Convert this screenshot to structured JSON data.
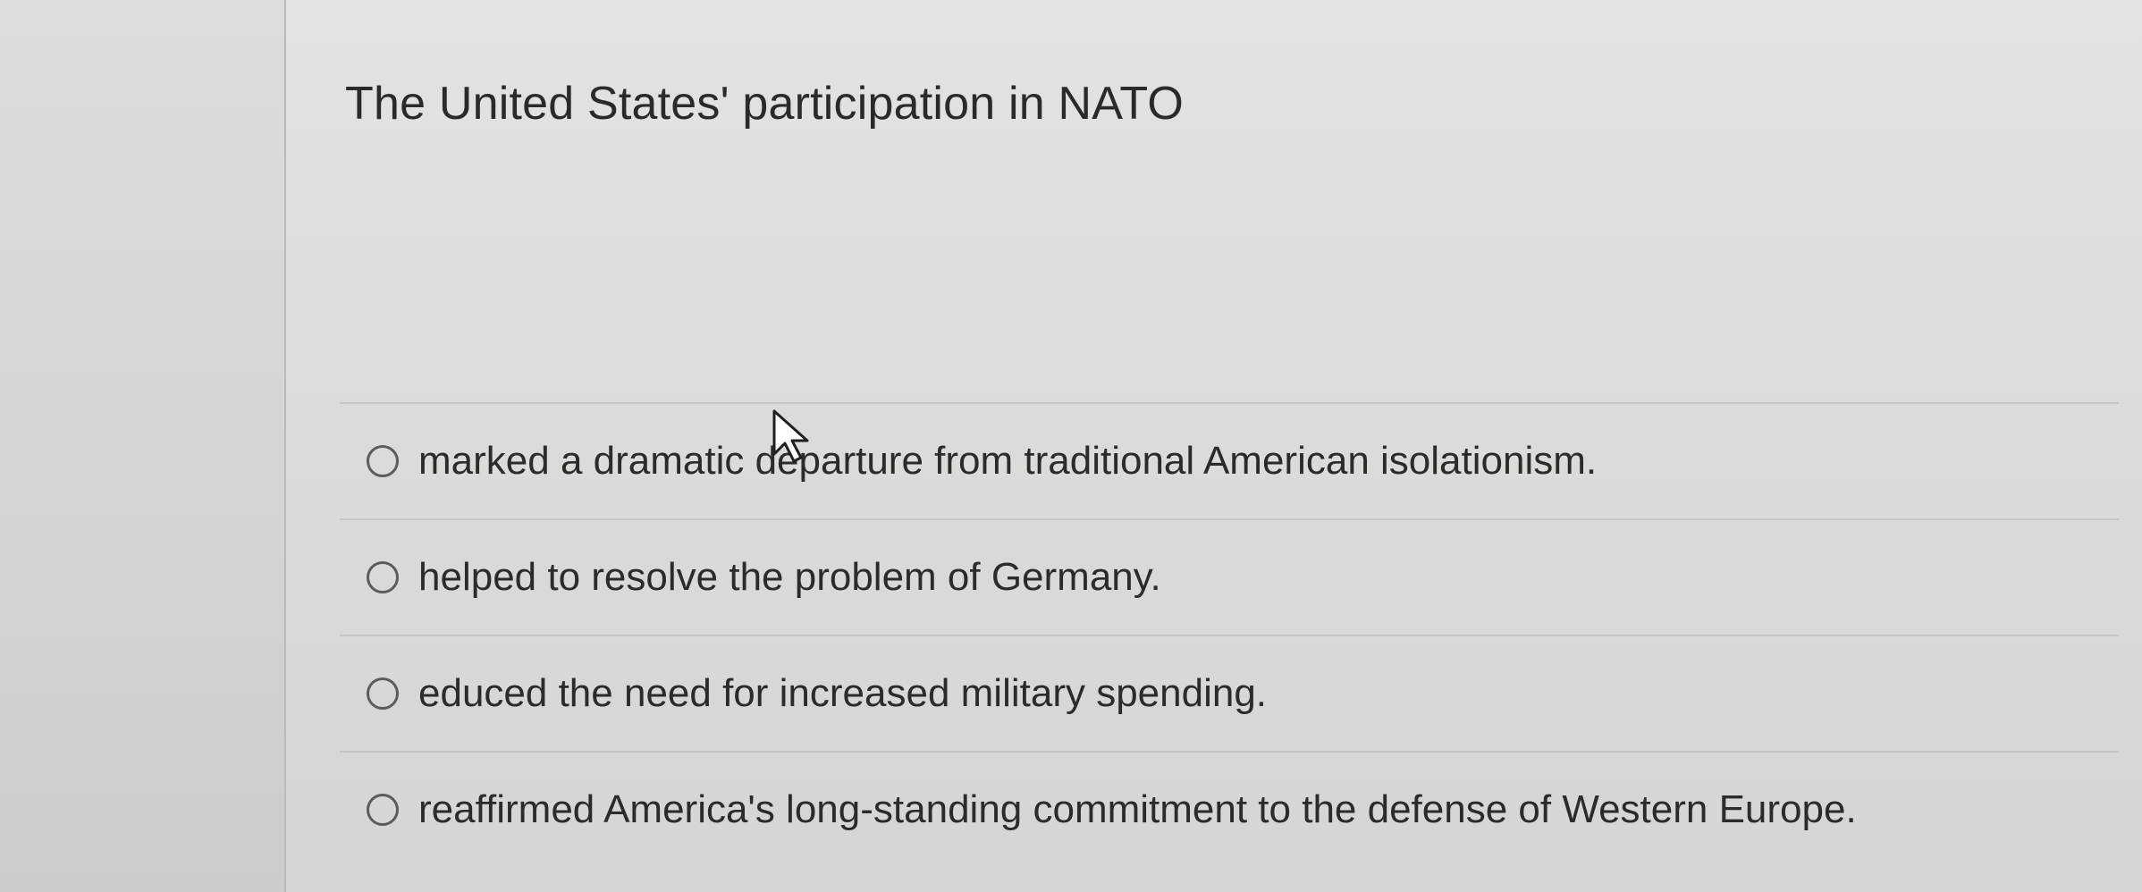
{
  "question": {
    "prompt": "The United States' participation in NATO"
  },
  "answers": [
    {
      "label": "marked a dramatic departure from traditional American isolationism."
    },
    {
      "label": "helped to resolve the problem of Germany."
    },
    {
      "label": "educed the need for increased military spending."
    },
    {
      "label": "reaffirmed America's long-standing commitment to the defense of Western Europe."
    }
  ],
  "icons": {
    "radio": "radio-button-icon",
    "cursor": "mouse-pointer-icon"
  },
  "colors": {
    "background": "#dcddda",
    "text": "#2a2a2a",
    "divider": "#c4c6c3",
    "radio_border": "#5b5d5a"
  }
}
